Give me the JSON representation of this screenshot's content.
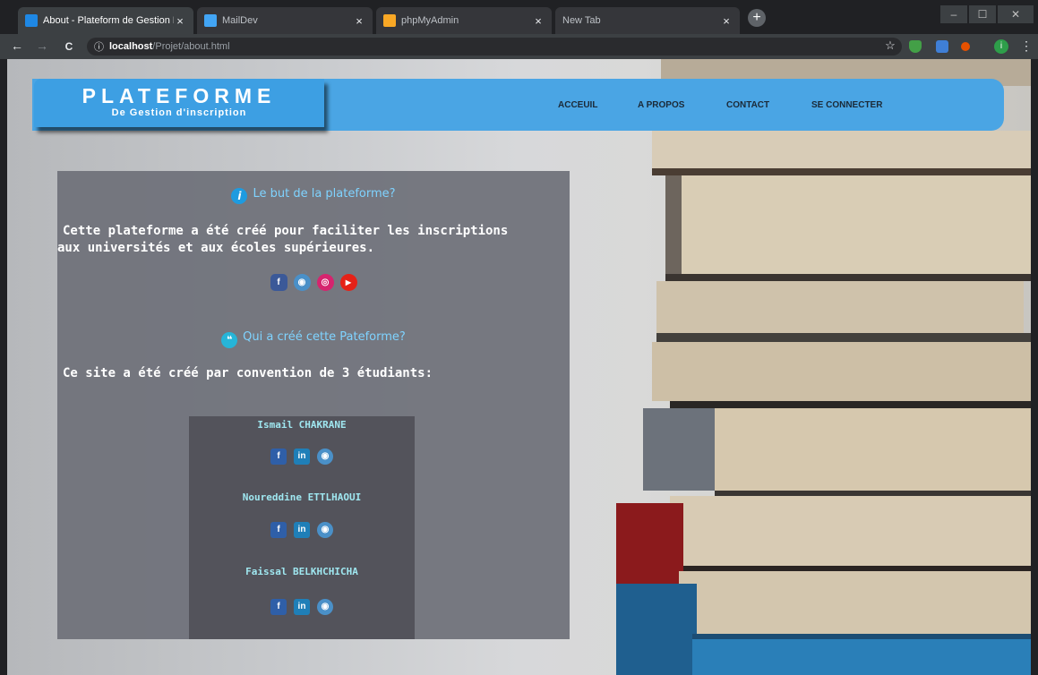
{
  "browser": {
    "tabs": [
      {
        "label": "About - Plateform de Gestion D'I",
        "close": "×",
        "active": true,
        "favicon_color": "#1e88e5"
      },
      {
        "label": "MailDev",
        "close": "×",
        "active": false,
        "favicon_color": "#42a5f5"
      },
      {
        "label": "phpMyAdmin",
        "close": "×",
        "active": false,
        "favicon_color": "#f9a825"
      },
      {
        "label": "New Tab",
        "close": "×",
        "active": false,
        "favicon_color": ""
      }
    ],
    "new_tab_label": "+",
    "window_controls": {
      "minimize": "–",
      "maximize": "☐",
      "close": "✕"
    },
    "nav": {
      "back": "←",
      "forward": "→",
      "reload": "C"
    },
    "address": {
      "info": "ⓘ",
      "host": "localhost",
      "path": "/Projet/about.html"
    },
    "bookmark_star": "☆",
    "profile_initial": "i"
  },
  "header": {
    "logo_title": "PLATEFORME",
    "logo_subtitle": "De Gestion d'inscription",
    "nav": [
      "ACCEUIL",
      "A PROPOS",
      "CONTACT",
      "SE CONNECTER"
    ]
  },
  "about": {
    "heading1": "Le but de la plateforme?",
    "heading1_icon": "i",
    "paragraph1_line1": "Cette plateforme a été créé pour faciliter les inscriptions",
    "paragraph1_line2": "aux universités et aux écoles supérieures.",
    "socials": [
      {
        "icon": "facebook-icon",
        "glyph": "f",
        "color": "#3b5998"
      },
      {
        "icon": "github-icon",
        "glyph": "◉",
        "color": "#4a90c8"
      },
      {
        "icon": "instagram-icon",
        "glyph": "◎",
        "color": "#d6246e"
      },
      {
        "icon": "youtube-icon",
        "glyph": "▶",
        "color": "#e62117"
      }
    ],
    "heading2": "Qui a créé cette Pateforme?",
    "heading2_icon": "❝",
    "paragraph2": "Ce site a été créé par convention de 3 étudiants:"
  },
  "members": [
    {
      "name": "Ismail CHAKRANE",
      "links": [
        "f",
        "in",
        "◉"
      ]
    },
    {
      "name": "Noureddine ETTLHAOUI",
      "links": [
        "f",
        "in",
        "◉"
      ]
    },
    {
      "name": "Faissal BELKHCHICHA",
      "links": [
        "f",
        "in",
        "◉"
      ]
    }
  ],
  "member_link_icons": [
    "facebook-icon",
    "linkedin-icon",
    "github-icon"
  ],
  "colors": {
    "header_blue": "#4aa5e4",
    "heading_cyan": "#7fd3ff",
    "member_name": "#9fe7f0"
  }
}
